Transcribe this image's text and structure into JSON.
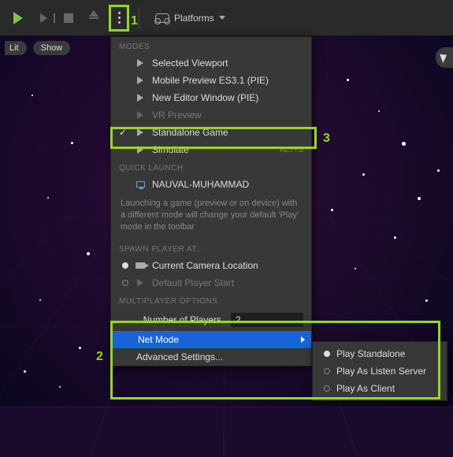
{
  "toolbar": {
    "platforms_label": "Platforms"
  },
  "chips": {
    "lit": "Lit",
    "show": "Show"
  },
  "annotations": {
    "one": "1",
    "two": "2",
    "three": "3"
  },
  "panel": {
    "sections": {
      "modes": "MODES",
      "quick_launch": "QUICK LAUNCH",
      "spawn": "SPAWN PLAYER AT...",
      "multi": "MULTIPLAYER OPTIONS"
    },
    "modes": {
      "selected_viewport": "Selected Viewport",
      "mobile_preview": "Mobile Preview ES3.1 (PIE)",
      "new_editor_window": "New Editor Window (PIE)",
      "vr_preview": "VR Preview",
      "standalone_game": "Standalone Game",
      "simulate": "Simulate",
      "simulate_shortcut": "ALT+S"
    },
    "quick_launch": {
      "device": "NAUVAL-MUHAMMAD"
    },
    "description": "Launching a game (preview or on device) with a different mode will change your default 'Play' mode in the toolbar",
    "spawn": {
      "current_camera": "Current Camera Location",
      "default_start": "Default Player Start"
    },
    "multi": {
      "num_players_label": "Number of Players",
      "num_players_value": "2",
      "net_mode": "Net Mode",
      "advanced": "Advanced Settings..."
    }
  },
  "submenu": {
    "play_standalone": "Play Standalone",
    "play_listen_server": "Play As Listen Server",
    "play_client": "Play As Client"
  }
}
